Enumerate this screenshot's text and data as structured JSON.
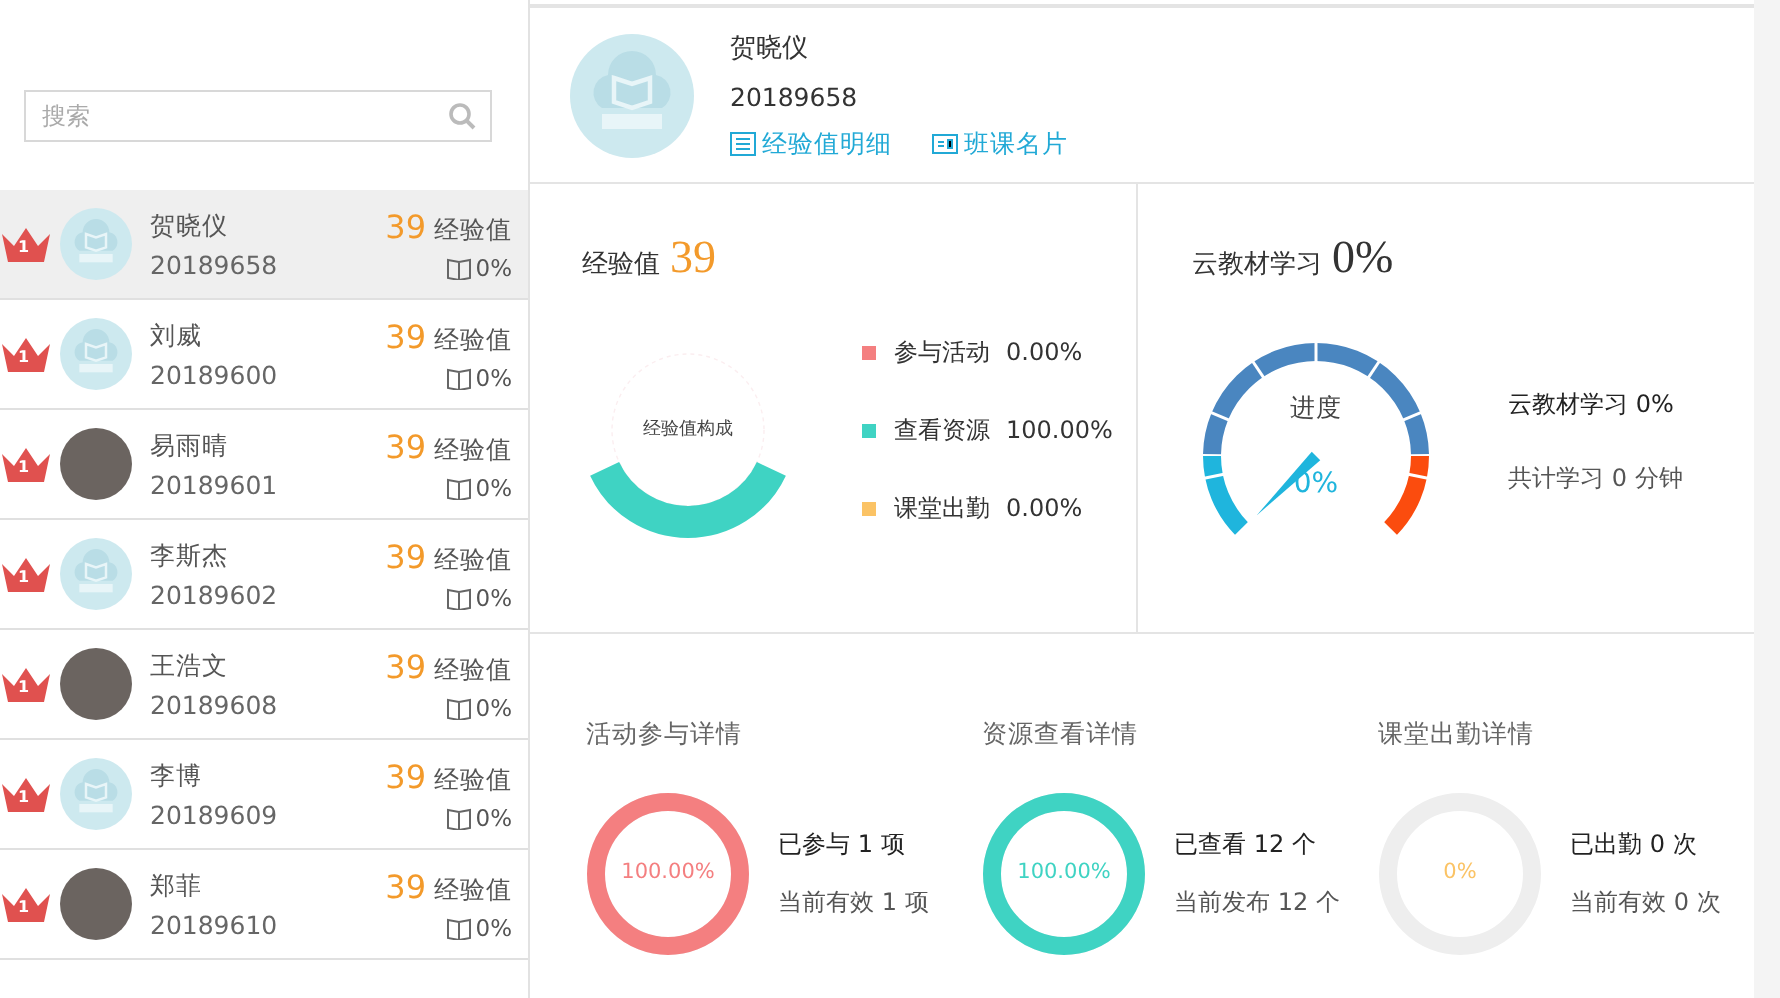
{
  "search": {
    "placeholder": "搜索"
  },
  "students": [
    {
      "rank": "1",
      "name": "贺晓仪",
      "id": "20189658",
      "score": "39",
      "score_unit": "经验值",
      "progress": "0%",
      "kind": "default",
      "selected": true
    },
    {
      "rank": "1",
      "name": "刘威",
      "id": "20189600",
      "score": "39",
      "score_unit": "经验值",
      "progress": "0%",
      "kind": "default",
      "selected": false
    },
    {
      "rank": "1",
      "name": "易雨晴",
      "id": "20189601",
      "score": "39",
      "score_unit": "经验值",
      "progress": "0%",
      "kind": "photo",
      "selected": false
    },
    {
      "rank": "1",
      "name": "李斯杰",
      "id": "20189602",
      "score": "39",
      "score_unit": "经验值",
      "progress": "0%",
      "kind": "default",
      "selected": false
    },
    {
      "rank": "1",
      "name": "王浩文",
      "id": "20189608",
      "score": "39",
      "score_unit": "经验值",
      "progress": "0%",
      "kind": "photo",
      "selected": false
    },
    {
      "rank": "1",
      "name": "李博",
      "id": "20189609",
      "score": "39",
      "score_unit": "经验值",
      "progress": "0%",
      "kind": "default",
      "selected": false
    },
    {
      "rank": "1",
      "name": "郑菲",
      "id": "20189610",
      "score": "39",
      "score_unit": "经验值",
      "progress": "0%",
      "kind": "photo",
      "selected": false
    }
  ],
  "profile": {
    "name": "贺晓仪",
    "id": "20189658",
    "links": [
      "经验值明细",
      "班课名片"
    ]
  },
  "experience": {
    "label": "经验值",
    "value": "39",
    "center_label": "经验值构成",
    "legend": [
      {
        "name": "参与活动",
        "value": "0.00%",
        "color": "#f47f80"
      },
      {
        "name": "查看资源",
        "value": "100.00%",
        "color": "#3fd3c3"
      },
      {
        "name": "课堂出勤",
        "value": "0.00%",
        "color": "#fbc365"
      }
    ]
  },
  "textbook": {
    "label": "云教材学习",
    "value": "0%",
    "gauge_label": "进度",
    "gauge_value": "0%",
    "lines": [
      "云教材学习 0%",
      "共计学习 0 分钟"
    ]
  },
  "details": [
    {
      "title": "活动参与详情",
      "percent": "100.00%",
      "level": 1,
      "color": "#f47f80",
      "lines": [
        "已参与 1 项",
        "当前有效 1 项"
      ]
    },
    {
      "title": "资源查看详情",
      "percent": "100.00%",
      "level": 1,
      "color": "#3fd3c3",
      "lines": [
        "已查看 12 个",
        "当前发布 12 个"
      ]
    },
    {
      "title": "课堂出勤详情",
      "percent": "0%",
      "level": 0,
      "color": "#fbc365",
      "lines": [
        "已出勤 0 次",
        "当前有效 0 次"
      ]
    }
  ]
}
